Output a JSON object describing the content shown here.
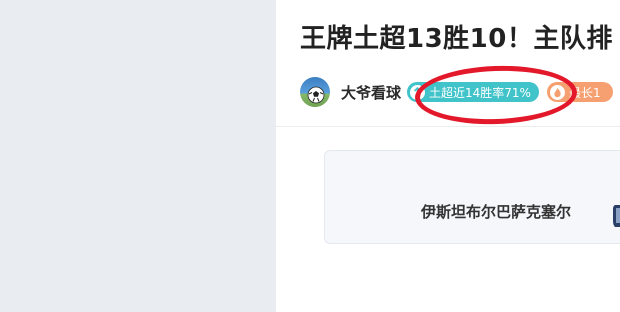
{
  "article": {
    "title": "王牌土超13胜10！主队排",
    "author": {
      "name": "大爷看球",
      "avatar_icon": "soccer-ball-avatar-icon"
    },
    "badges": [
      {
        "label": "土超近14胜率71%",
        "icon": "arrow-up-icon",
        "color": "#40c3c9"
      },
      {
        "label": "最长1",
        "icon": "flame-icon",
        "color": "#f6a072"
      }
    ]
  },
  "match_card": {
    "home_team": "伊斯坦布尔巴萨克塞尔",
    "team_logo_icon": "club-crest-icon"
  },
  "annotation": {
    "type": "hand-drawn-ellipse",
    "color": "#e3182b"
  },
  "colors": {
    "left_panel_bg": "#e9ecf1",
    "card_bg": "#f6f7fb"
  }
}
